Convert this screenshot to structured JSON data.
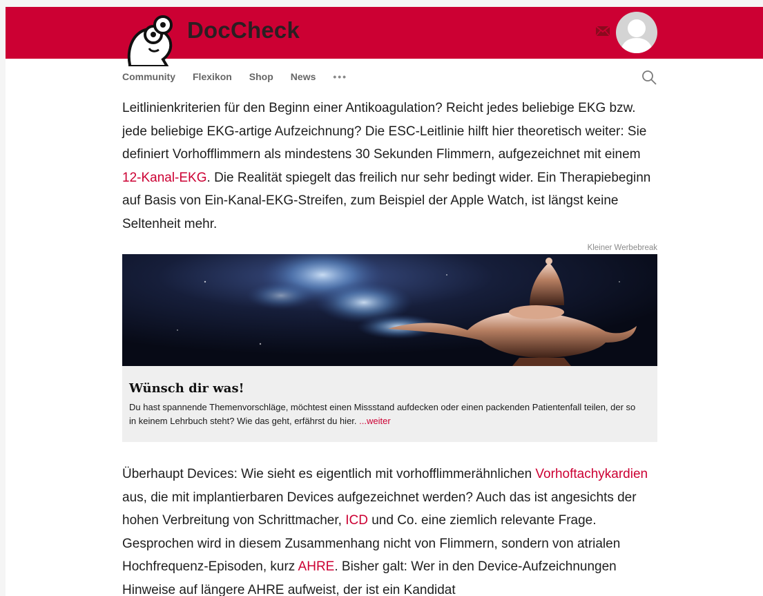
{
  "header": {
    "brand": "DocCheck",
    "colors": {
      "brand_red": "#cc0033",
      "link_red": "#cc0033"
    },
    "icons": {
      "logo": "doccheck-mascot-logo",
      "mail": "mail-icon",
      "avatar": "user-avatar-icon",
      "search": "search-icon"
    }
  },
  "nav": {
    "items": [
      "Community",
      "Flexikon",
      "Shop",
      "News"
    ],
    "more": "•••"
  },
  "article": {
    "para1": {
      "before_link": "Leitlinienkriterien für den Beginn einer Antikoagulation? Reicht jedes beliebige EKG bzw. jede beliebige EKG-artige Aufzeichnung? Die ESC-Leitlinie hilft hier theo­retisch weiter: Sie definiert Vorhofflimmern als mindestens 30 Sekunden Flim­mern, aufgezeichnet mit einem ",
      "link": "12-Kanal-EKG",
      "after_link": ". Die Realität spiegelt das freilich nur sehr bedingt wider. Ein Therapiebeginn auf Basis von Ein-Kanal-EKG-Streifen, zum Beispiel der Apple Watch, ist längst keine Seltenheit mehr."
    },
    "para2": {
      "t1": "Überhaupt Devices: Wie sieht es eigentlich mit vorhofflimmerähnlichen ",
      "link1": "Vorhofta­chykardien",
      "t2": " aus, die mit implantierbaren Devices aufgezeichnet werden? Auch das ist angesichts der hohen Verbreitung von Schrittmacher, ",
      "link2": "ICD",
      "t3": " und Co. eine ziemlich relevante Frage. Gesprochen wird in diesem Zusammenhang nicht von Flimmern, sondern von atrialen Hochfrequenz-Episoden, kurz ",
      "link3": "AHRE",
      "t4": ". Bisher galt: Wer in den Device-Aufzeichnungen Hinweise auf längere AHRE aufweist, der ist ein Kandidat"
    }
  },
  "ad": {
    "label": "Kleiner Werbebreak",
    "image": "magic-lamp-image",
    "title": "Wünsch dir was!",
    "body": "Du hast spannende Themenvorschläge, möchtest einen Missstand aufdecken oder einen packenden Patientenfall teilen, der so in keinem Lehrbuch steht? Wie das geht, erfährst du hier. ",
    "link": "...weiter"
  }
}
